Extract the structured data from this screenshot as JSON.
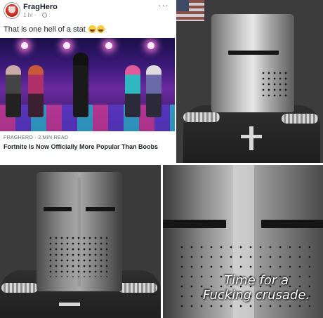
{
  "fb_post": {
    "page_name": "FragHero",
    "time": "1 hr ·",
    "more_label": "···",
    "text": "That is one hell of a stat",
    "emojis": [
      "laughing-tears-emoji",
      "laughing-tears-emoji"
    ],
    "link": {
      "source": "FRAGHERO · 2 MIN READ",
      "title": "Fortnite Is Now Officially More Popular Than Boobs"
    }
  },
  "panels": {
    "bottom_right": {
      "caption_line1": "Time for a",
      "caption_line2": "Fucking crusade."
    }
  }
}
